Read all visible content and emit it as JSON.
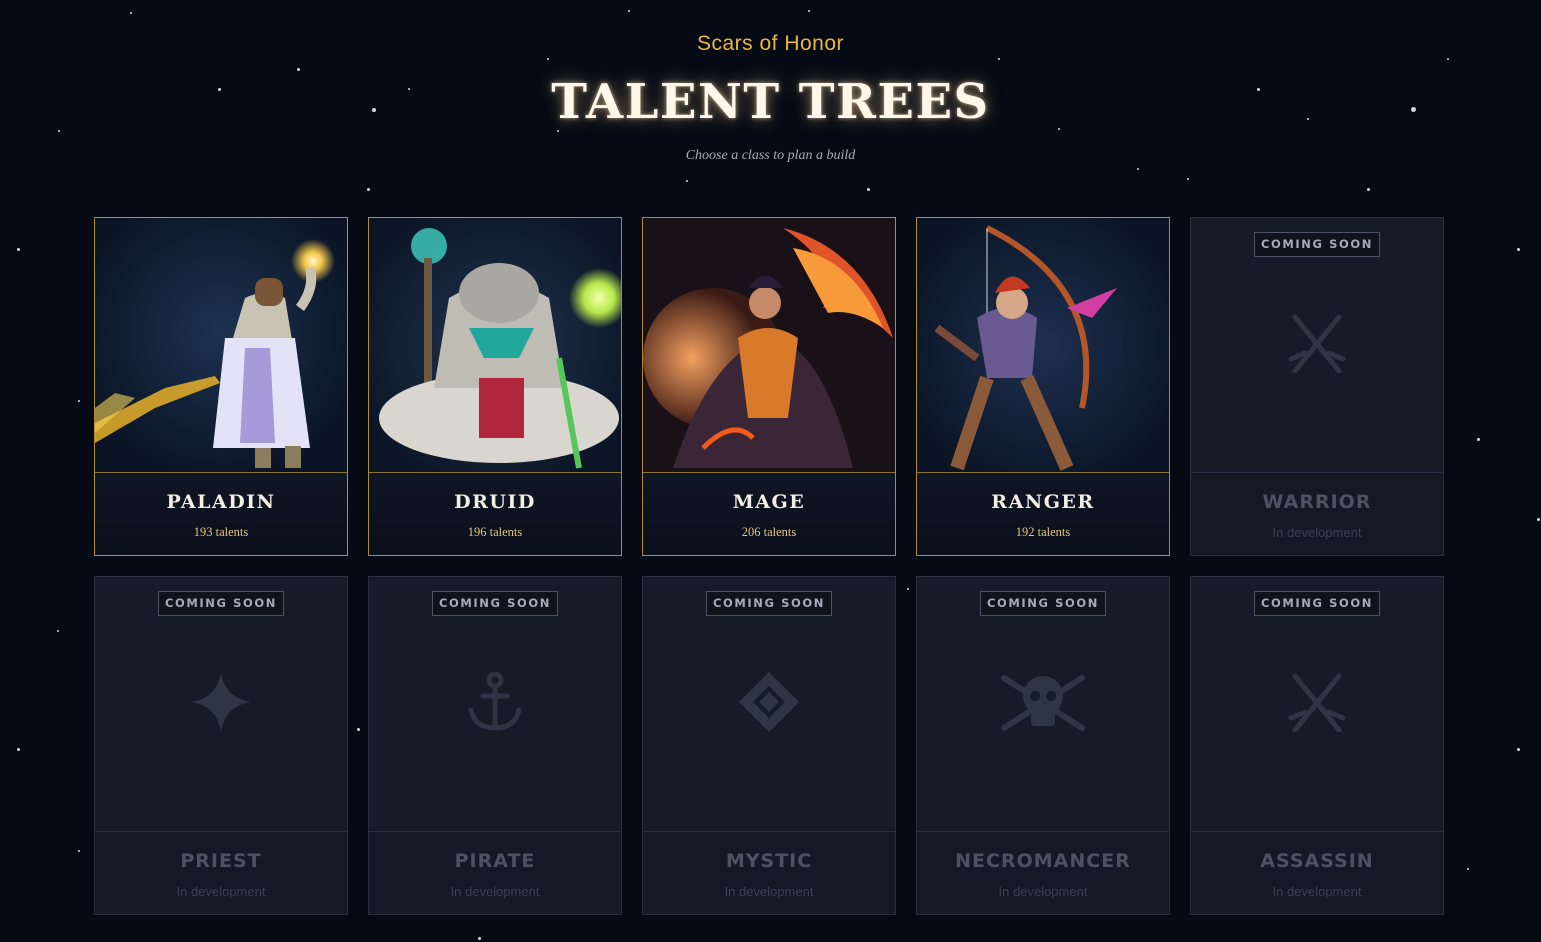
{
  "header": {
    "game_title": "Scars of Honor",
    "page_title": "TALENT TREES",
    "tagline": "Choose a class to plan a build"
  },
  "colors": {
    "accent_gold": "#e8b93e",
    "card_border_active": "#b48b33",
    "background": "#060a14"
  },
  "classes_row1": [
    {
      "name": "PALADIN",
      "count": "193 talents",
      "status": "available"
    },
    {
      "name": "DRUID",
      "count": "196 talents",
      "status": "available"
    },
    {
      "name": "MAGE",
      "count": "206 talents",
      "status": "available"
    },
    {
      "name": "RANGER",
      "count": "192 talents",
      "status": "available"
    },
    {
      "name": "WARRIOR",
      "count": "In development",
      "badge": "COMING SOON",
      "icon": "crossed-swords-icon",
      "status": "locked"
    }
  ],
  "classes_row2": [
    {
      "name": "PRIEST",
      "count": "In development",
      "badge": "COMING SOON",
      "icon": "four-point-star-icon",
      "status": "locked"
    },
    {
      "name": "PIRATE",
      "count": "In development",
      "badge": "COMING SOON",
      "icon": "anchor-icon",
      "status": "locked"
    },
    {
      "name": "MYSTIC",
      "count": "In development",
      "badge": "COMING SOON",
      "icon": "diamond-icon",
      "status": "locked"
    },
    {
      "name": "NECROMANCER",
      "count": "In development",
      "badge": "COMING SOON",
      "icon": "skull-crossbones-icon",
      "status": "locked"
    },
    {
      "name": "ASSASSIN",
      "count": "In development",
      "badge": "COMING SOON",
      "icon": "crossed-swords-icon",
      "status": "locked"
    }
  ]
}
